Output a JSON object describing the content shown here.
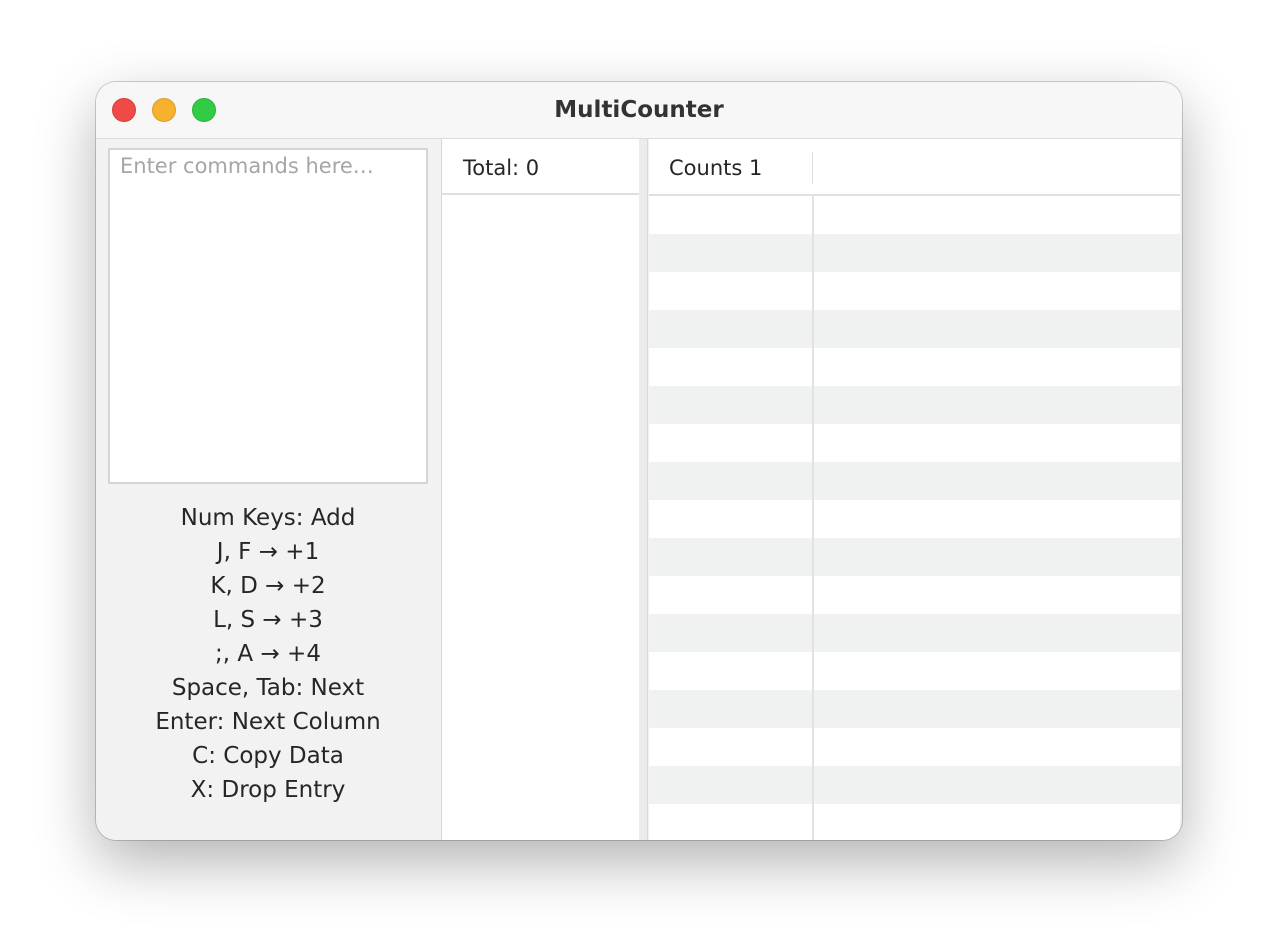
{
  "window": {
    "title": "MultiCounter"
  },
  "command_input": {
    "placeholder": "Enter commands here…",
    "value": ""
  },
  "help": [
    "Num Keys: Add",
    "J, F → +1",
    "K, D → +2",
    "L, S → +3",
    ";, A → +4",
    "Space, Tab: Next",
    "Enter: Next Column",
    "C: Copy Data",
    "X: Drop Entry"
  ],
  "total": {
    "label": "Total: 0"
  },
  "table": {
    "columns": [
      "Counts 1"
    ],
    "rows": []
  },
  "colors": {
    "close": "#ef4a47",
    "minimize": "#f6b22f",
    "zoom": "#32cb46",
    "row_alt": "#f0f2f2"
  }
}
